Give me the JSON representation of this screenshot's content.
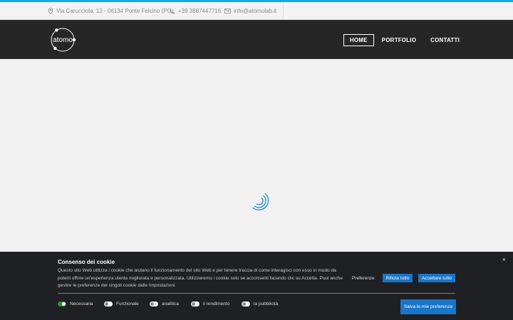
{
  "topbar": {
    "address": "Via Carucciola, 12 - 06134 Ponte Felcino (PG)",
    "phone": "+39 3887447716",
    "email": "info@atomolab.it"
  },
  "header": {
    "logo_text": "atomo",
    "nav": [
      {
        "label": "HOME",
        "active": true
      },
      {
        "label": "PORTFOLIO",
        "active": false
      },
      {
        "label": "CONTATTI",
        "active": false
      }
    ]
  },
  "cookie": {
    "close_label": "×",
    "title": "Consenso dei cookie",
    "text": "Questo sito Web utilizza i cookie che aiutano il funzionamento del sito Web e per tenere traccia di come interagisci con esso in modo da poterti offrire un'esperienza utente migliorata e personalizzata. Utilizzeremo i cookie solo se acconsenti facendo clic su Accetta. Puoi anche gestire le preferenze dei singoli cookie dalle Impostazioni.",
    "preferences_label": "Preferenze",
    "reject_label": "Rifiuta tutto",
    "accept_label": "Accettare tutto",
    "toggles": [
      {
        "label": "Necessaria",
        "on": true
      },
      {
        "label": "Funzionale",
        "on": false
      },
      {
        "label": "analitica",
        "on": false
      },
      {
        "label": "il rendimento",
        "on": false
      },
      {
        "label": "la pubblicità",
        "on": false
      }
    ],
    "save_label": "Salva le mie preferenze"
  },
  "colors": {
    "accent": "#19a8e0",
    "header_bg": "#262626",
    "cookie_bg": "#1e2024",
    "button_blue": "#1976c9",
    "toggle_on": "#2e8b3a"
  }
}
